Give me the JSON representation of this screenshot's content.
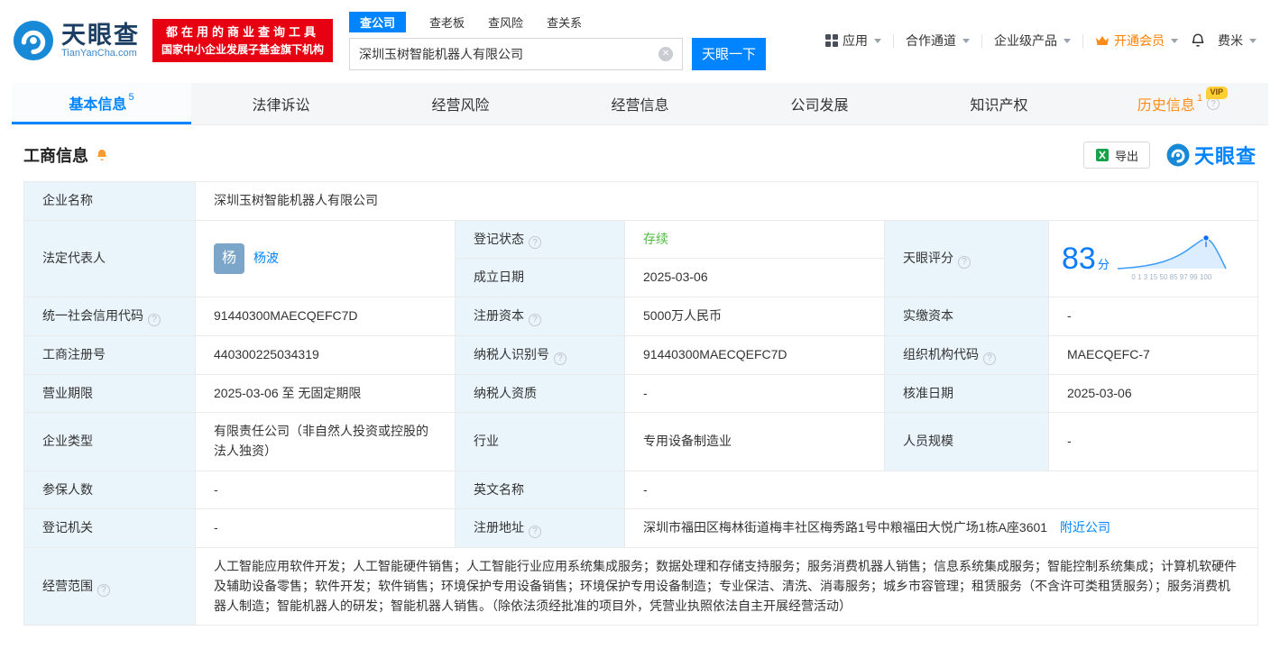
{
  "header": {
    "logo_title": "天眼查",
    "logo_subtitle": "TianYanCha.com",
    "promo_line1": "都在用的商业查询工具",
    "promo_line2": "国家中小企业发展子基金旗下机构",
    "search_tabs": {
      "company": "查公司",
      "boss": "查老板",
      "risk": "查风险",
      "relation": "查关系"
    },
    "search_value": "深圳玉树智能机器人有限公司",
    "search_button": "天眼一下",
    "nav_app": "应用",
    "nav_coop": "合作通道",
    "nav_enterprise": "企业级产品",
    "nav_vip": "开通会员",
    "nav_user": "费米"
  },
  "tabs": {
    "basic": "基本信息",
    "basic_badge": "5",
    "legal": "法律诉讼",
    "risk": "经营风险",
    "operation": "经营信息",
    "development": "公司发展",
    "ip": "知识产权",
    "history": "历史信息",
    "history_badge": "1",
    "history_vip": "VIP"
  },
  "section": {
    "title": "工商信息",
    "export": "导出",
    "brand": "天眼查"
  },
  "colors": {
    "accent_blue": "#0084ff",
    "promo_red": "#e60012",
    "status_green": "#4cbb3c",
    "vip_orange": "#ff8000"
  },
  "table": {
    "company_name_label": "企业名称",
    "company_name": "深圳玉树智能机器人有限公司",
    "legal_rep_label": "法定代表人",
    "legal_rep_avatar": "杨",
    "legal_rep_name": "杨波",
    "reg_status_label": "登记状态",
    "reg_status": "存续",
    "score_label": "天眼评分",
    "score_value": "83",
    "score_unit": "分",
    "score_axis": "0 1 3 15 50 85 97 99 100",
    "est_date_label": "成立日期",
    "est_date": "2025-03-06",
    "credit_code_label": "统一社会信用代码",
    "credit_code": "91440300MAECQEFC7D",
    "reg_capital_label": "注册资本",
    "reg_capital": "5000万人民币",
    "paid_capital_label": "实缴资本",
    "paid_capital": "-",
    "reg_number_label": "工商注册号",
    "reg_number": "440300225034319",
    "taxpayer_id_label": "纳税人识别号",
    "taxpayer_id": "91440300MAECQEFC7D",
    "org_code_label": "组织机构代码",
    "org_code": "MAECQEFC-7",
    "business_term_label": "营业期限",
    "business_term": "2025-03-06 至 无固定期限",
    "taxpayer_quality_label": "纳税人资质",
    "taxpayer_quality": "-",
    "approval_date_label": "核准日期",
    "approval_date": "2025-03-06",
    "company_type_label": "企业类型",
    "company_type": "有限责任公司（非自然人投资或控股的法人独资）",
    "industry_label": "行业",
    "industry": "专用设备制造业",
    "staff_size_label": "人员规模",
    "staff_size": "-",
    "insured_label": "参保人数",
    "insured": "-",
    "english_name_label": "英文名称",
    "english_name": "-",
    "reg_authority_label": "登记机关",
    "reg_authority": "-",
    "address_label": "注册地址",
    "address": "深圳市福田区梅林街道梅丰社区梅秀路1号中粮福田大悦广场1栋A座3601",
    "address_nearby": "附近公司",
    "business_scope_label": "经营范围",
    "business_scope": "人工智能应用软件开发；人工智能硬件销售；人工智能行业应用系统集成服务；数据处理和存储支持服务；服务消费机器人销售；信息系统集成服务；智能控制系统集成；计算机软硬件及辅助设备零售；软件开发；软件销售；环境保护专用设备销售；环境保护专用设备制造；专业保洁、清洗、消毒服务；城乡市容管理；租赁服务（不含许可类租赁服务）；服务消费机器人制造；智能机器人的研发；智能机器人销售。（除依法须经批准的项目外，凭营业执照依法自主开展经营活动）"
  }
}
